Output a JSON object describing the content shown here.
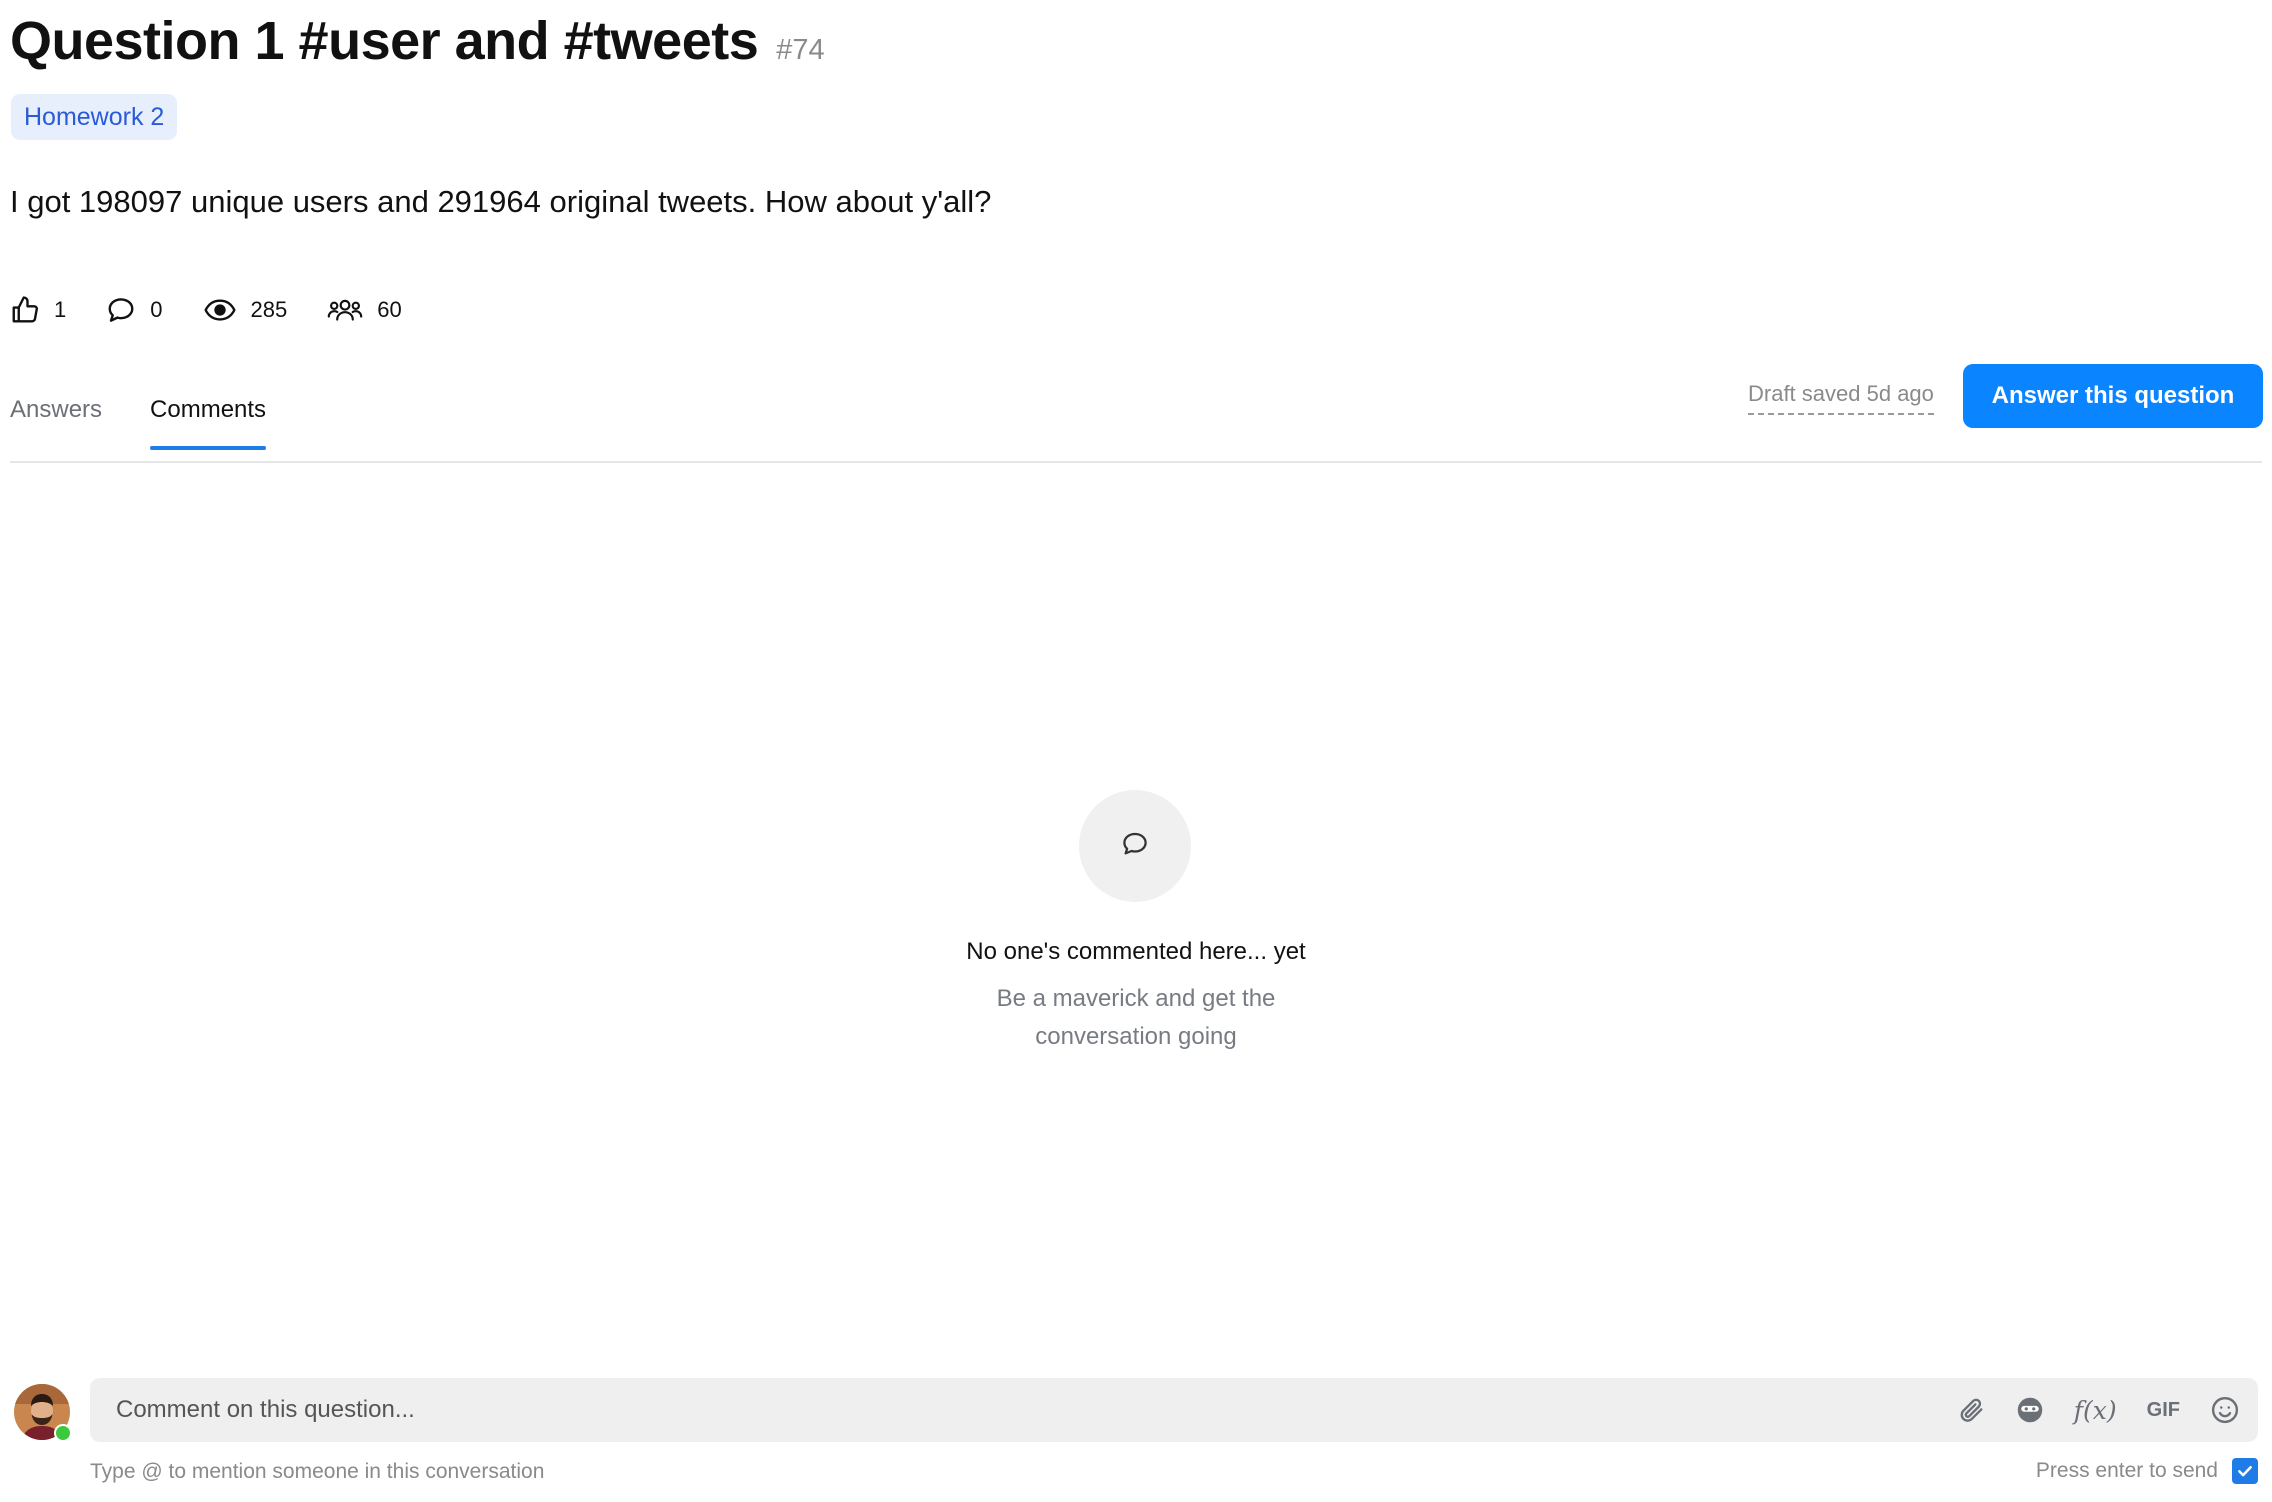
{
  "question": {
    "title": "Question 1 #user and #tweets",
    "number": "#74",
    "tag": "Homework 2",
    "body": "I got 198097 unique users and 291964 original tweets. How about y'all?"
  },
  "stats": {
    "likes": "1",
    "comments": "0",
    "views": "285",
    "participants": "60"
  },
  "tabs": [
    {
      "label": "Answers",
      "active": false
    },
    {
      "label": "Comments",
      "active": true
    }
  ],
  "draft_status": "Draft saved 5d ago",
  "answer_button": "Answer this question",
  "empty_state": {
    "icon": "speech-bubble-icon",
    "title": "No one's commented here... yet",
    "subtitle": "Be a maverick and get the conversation going"
  },
  "composer": {
    "placeholder": "Comment on this question...",
    "tools": [
      "paperclip-icon",
      "anonymous-mask-icon",
      "f(x)",
      "GIF",
      "emoji-icon"
    ],
    "hint": "Type @ to mention someone in this conversation",
    "enter_to_send_label": "Press enter to send",
    "enter_to_send_checked": true
  },
  "colors": {
    "accent": "#0a84ff",
    "tag_bg": "#e7eefc",
    "tag_text": "#2a5bd7",
    "online": "#3cc93c"
  }
}
